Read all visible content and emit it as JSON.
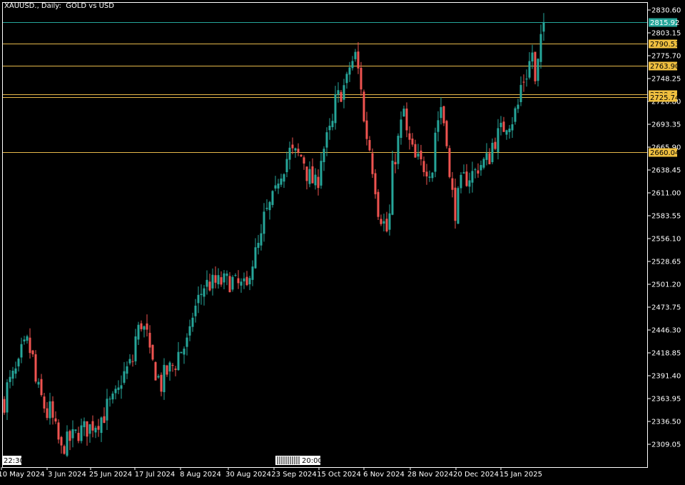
{
  "header": {
    "symbol": "XAUUSD.",
    "timeframe": "Daily:",
    "description": "GOLD vs USD"
  },
  "time_tags": {
    "left": "22:30",
    "center": "20:00"
  },
  "colors": {
    "background": "#000000",
    "frame": "#ffffff",
    "bull": "#26a69a",
    "bear": "#ef5350",
    "level_line": "#e6b84a",
    "level_label_bg": "#f0c040",
    "price_line": "#26a69a"
  },
  "price_label": "2815.92",
  "levels": [
    "2790.53",
    "2763.90",
    "2729.64",
    "2725.74",
    "2660.04"
  ],
  "chart_data": {
    "type": "candlestick",
    "y_ticks": [
      "2830.60",
      "2803.15",
      "2775.70",
      "2748.25",
      "2720.80",
      "2693.35",
      "2665.90",
      "2638.45",
      "2611.00",
      "2583.55",
      "2556.10",
      "2528.65",
      "2501.20",
      "2473.75",
      "2446.30",
      "2418.85",
      "2391.40",
      "2363.95",
      "2336.50",
      "2309.05"
    ],
    "x_ticks": [
      "10 May 2024",
      "3 Jun 2024",
      "25 Jun 2024",
      "17 Jul 2024",
      "8 Aug 2024",
      "30 Aug 2024",
      "23 Sep 2024",
      "15 Oct 2024",
      "6 Nov 2024",
      "28 Nov 2024",
      "20 Dec 2024",
      "15 Jan 2025"
    ],
    "ylim": [
      2296,
      2842
    ],
    "close_path": [
      [
        "10 May 2024",
        2360
      ],
      [
        "22 May 2024",
        2430
      ],
      [
        "31 May 2024",
        2345
      ],
      [
        "3 Jun 2024",
        2350
      ],
      [
        "7 Jun 2024",
        2300
      ],
      [
        "14 Jun 2024",
        2320
      ],
      [
        "25 Jun 2024",
        2335
      ],
      [
        "3 Jul 2024",
        2360
      ],
      [
        "12 Jul 2024",
        2410
      ],
      [
        "17 Jul 2024",
        2455
      ],
      [
        "26 Jul 2024",
        2380
      ],
      [
        "8 Aug 2024",
        2430
      ],
      [
        "16 Aug 2024",
        2500
      ],
      [
        "30 Aug 2024",
        2505
      ],
      [
        "6 Sep 2024",
        2495
      ],
      [
        "16 Sep 2024",
        2580
      ],
      [
        "23 Sep 2024",
        2630
      ],
      [
        "27 Sep 2024",
        2660
      ],
      [
        "3 Oct 2024",
        2655
      ],
      [
        "10 Oct 2024",
        2620
      ],
      [
        "15 Oct 2024",
        2665
      ],
      [
        "21 Oct 2024",
        2720
      ],
      [
        "30 Oct 2024",
        2775
      ],
      [
        "1 Nov 2024",
        2740
      ],
      [
        "6 Nov 2024",
        2665
      ],
      [
        "8 Nov 2024",
        2620
      ],
      [
        "14 Nov 2024",
        2565
      ],
      [
        "22 Nov 2024",
        2710
      ],
      [
        "28 Nov 2024",
        2650
      ],
      [
        "6 Dec 2024",
        2640
      ],
      [
        "11 Dec 2024",
        2715
      ],
      [
        "18 Dec 2024",
        2590
      ],
      [
        "20 Dec 2024",
        2620
      ],
      [
        "2 Jan 2025",
        2650
      ],
      [
        "10 Jan 2025",
        2690
      ],
      [
        "15 Jan 2025",
        2700
      ],
      [
        "22 Jan 2025",
        2755
      ],
      [
        "24 Jan 2025",
        2780
      ],
      [
        "27 Jan 2025",
        2740
      ],
      [
        "30 Jan 2025",
        2815.92
      ]
    ]
  }
}
